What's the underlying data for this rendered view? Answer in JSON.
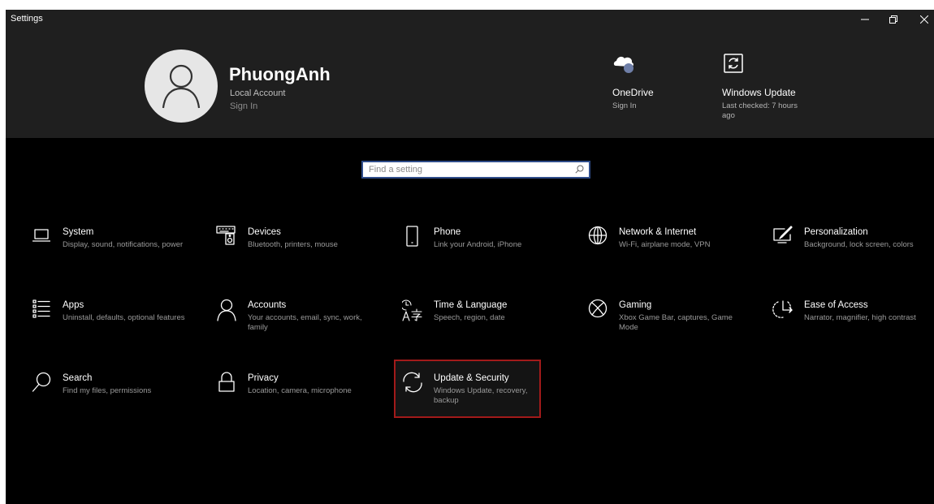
{
  "window": {
    "title": "Settings"
  },
  "window_controls": {
    "minimize_icon": "minimize-icon",
    "restore_icon": "restore-icon",
    "close_icon": "close-icon"
  },
  "profile": {
    "name": "PhuongAnh",
    "account_type": "Local Account",
    "sign_in": "Sign In",
    "avatar_icon": "user-icon"
  },
  "quick_links": {
    "onedrive": {
      "title": "OneDrive",
      "subtitle": "Sign In",
      "icon": "cloud-icon"
    },
    "windows_update": {
      "title": "Windows Update",
      "subtitle": "Last checked: 7 hours ago",
      "icon": "refresh-icon"
    }
  },
  "search": {
    "placeholder": "Find a setting",
    "icon": "search-icon"
  },
  "categories": [
    {
      "title": "System",
      "description": "Display, sound, notifications, power",
      "icon": "laptop-icon"
    },
    {
      "title": "Devices",
      "description": "Bluetooth, printers, mouse",
      "icon": "keyboard-speaker-icon"
    },
    {
      "title": "Phone",
      "description": "Link your Android, iPhone",
      "icon": "phone-icon"
    },
    {
      "title": "Network & Internet",
      "description": "Wi-Fi, airplane mode, VPN",
      "icon": "globe-icon"
    },
    {
      "title": "Personalization",
      "description": "Background, lock screen, colors",
      "icon": "paint-brush-icon"
    },
    {
      "title": "Apps",
      "description": "Uninstall, defaults, optional features",
      "icon": "apps-list-icon"
    },
    {
      "title": "Accounts",
      "description": "Your accounts, email, sync, work, family",
      "icon": "person-icon"
    },
    {
      "title": "Time & Language",
      "description": "Speech, region, date",
      "icon": "time-language-icon"
    },
    {
      "title": "Gaming",
      "description": "Xbox Game Bar, captures, Game Mode",
      "icon": "xbox-icon"
    },
    {
      "title": "Ease of Access",
      "description": "Narrator, magnifier, high contrast",
      "icon": "ease-of-access-icon"
    },
    {
      "title": "Search",
      "description": "Find my files, permissions",
      "icon": "magnifier-icon"
    },
    {
      "title": "Privacy",
      "description": "Location, camera, microphone",
      "icon": "lock-icon"
    },
    {
      "title": "Update & Security",
      "description": "Windows Update, recovery, backup",
      "icon": "update-sync-icon"
    }
  ],
  "highlight": {
    "category": "Update & Security",
    "color": "#a21a1a"
  },
  "colors": {
    "background": "#000000",
    "header": "#1f1f1f",
    "search_border": "#2f4d8a"
  }
}
